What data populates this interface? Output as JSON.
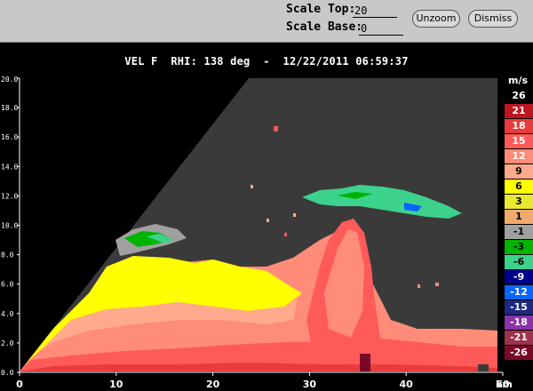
{
  "controls": {
    "scale_top_label": "Scale Top:",
    "scale_top_value": "20",
    "scale_base_label": "Scale Base:",
    "scale_base_value": "0",
    "unzoom_label": "Unzoom",
    "dismiss_label": "Dismiss"
  },
  "plot": {
    "title": "VEL F  RHI: 138 deg  -  12/22/2011 06:59:37",
    "x_unit": "km"
  },
  "chart_data": {
    "type": "heatmap",
    "title": "VEL F  RHI: 138 deg  -  12/22/2011 06:59:37",
    "xlabel": "km",
    "ylabel": "",
    "xlim": [
      0,
      50
    ],
    "ylim": [
      0,
      20
    ],
    "x_ticks": [
      "0",
      "10",
      "20",
      "30",
      "40",
      "50"
    ],
    "y_ticks": [
      "0.0",
      "2.0",
      "4.0",
      "6.0",
      "8.0",
      "10.0",
      "12.0",
      "14.0",
      "16.0",
      "18.0",
      "20.0"
    ],
    "colorbar": {
      "unit": "m/s",
      "levels": [
        "26",
        "21",
        "18",
        "15",
        "12",
        "9",
        "6",
        "3",
        "1",
        "-1",
        "-3",
        "-6",
        "-9",
        "-12",
        "-15",
        "-18",
        "-21",
        "-26"
      ],
      "colors": [
        "#000000",
        "#c0141e",
        "#e83c3c",
        "#ff5a5a",
        "#ff8c78",
        "#ffaa8c",
        "#ffff00",
        "#e8e830",
        "#f0aa6e",
        "#a0a0a0",
        "#00b400",
        "#3cd28c",
        "#00008c",
        "#0a64ff",
        "#1e2882",
        "#8c32aa",
        "#a03250",
        "#780a28"
      ],
      "text_colors": [
        "#ffffff",
        "#ffffff",
        "#ffffff",
        "#ffffff",
        "#ffffff",
        "#000000",
        "#000000",
        "#000000",
        "#000000",
        "#000000",
        "#000000",
        "#000000",
        "#ffffff",
        "#ffffff",
        "#ffffff",
        "#ffffff",
        "#ffffff",
        "#ffffff"
      ]
    },
    "background_color": "#3a3a3a",
    "grid": false
  }
}
